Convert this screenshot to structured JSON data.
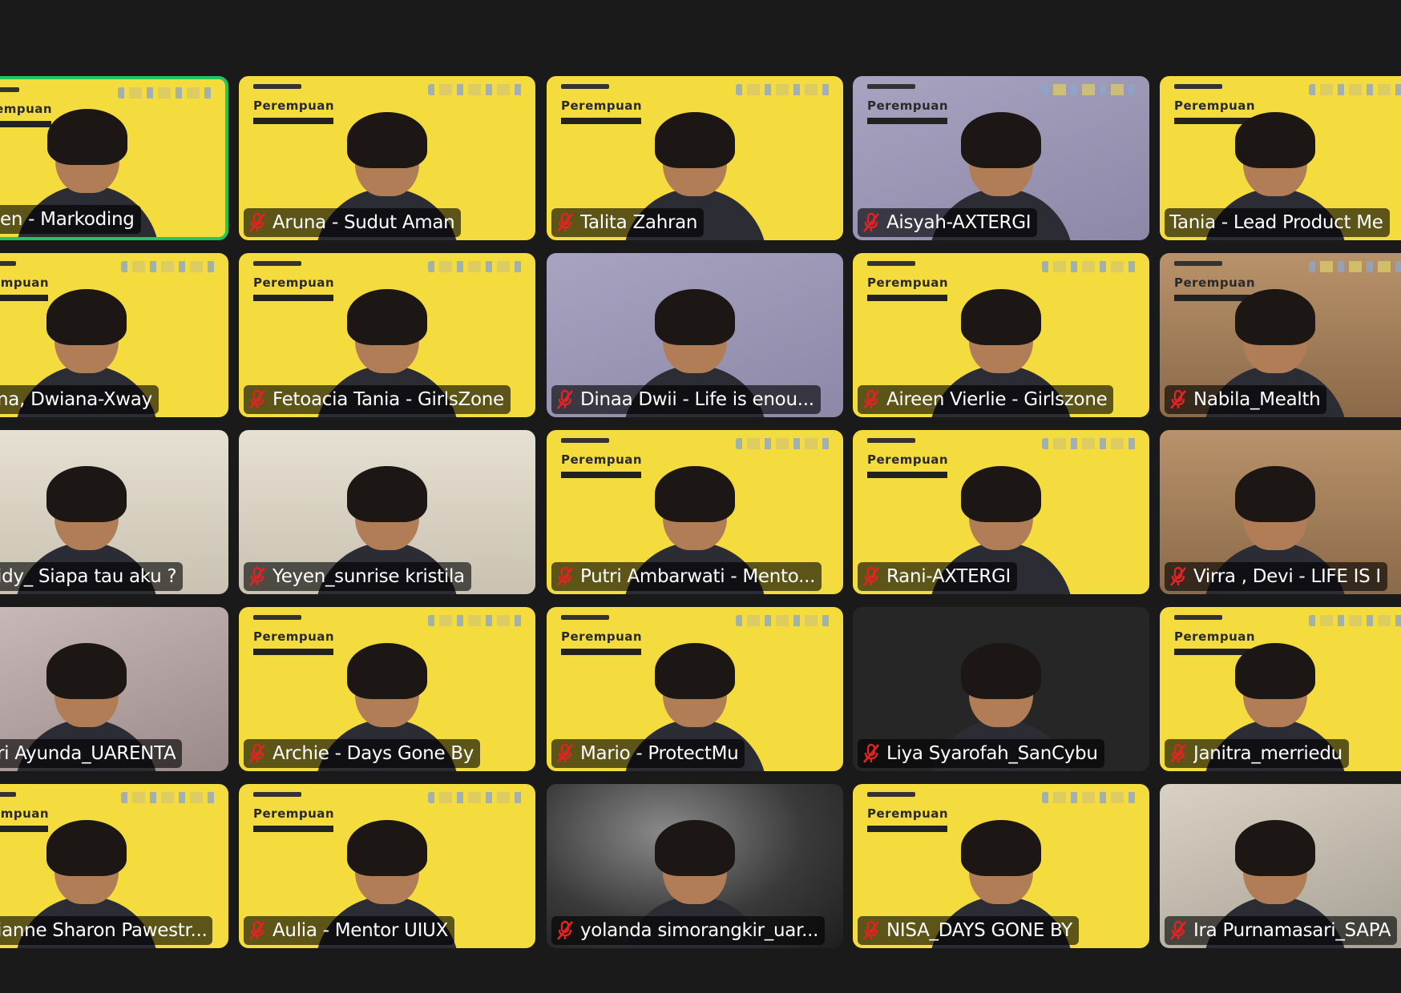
{
  "meeting": {
    "accent_color": "#22c55e",
    "muted_icon": "mic-muted-icon",
    "participants": [
      {
        "id": "p1",
        "name": "en - Markoding",
        "muted": false,
        "active": true,
        "bg": "bg-yellow",
        "branded": true
      },
      {
        "id": "p2",
        "name": "Aruna - Sudut Aman",
        "muted": true,
        "bg": "bg-yellow",
        "branded": true
      },
      {
        "id": "p3",
        "name": "Talita Zahran",
        "muted": true,
        "bg": "bg-yellow",
        "branded": true
      },
      {
        "id": "p4",
        "name": "Aisyah-AXTERGI",
        "muted": true,
        "bg": "bg-purple",
        "branded": true
      },
      {
        "id": "p5",
        "name": "Tania - Lead Product Me",
        "muted": false,
        "bg": "bg-yellow",
        "branded": true
      },
      {
        "id": "p6",
        "name": "na, Dwiana-Xway",
        "muted": false,
        "bg": "bg-yellow",
        "branded": true
      },
      {
        "id": "p7",
        "name": "Fetoacia Tania - GirlsZone",
        "muted": true,
        "bg": "bg-yellow",
        "branded": true
      },
      {
        "id": "p8",
        "name": "Dinaa Dwii - Life is enou...",
        "muted": true,
        "bg": "bg-purple",
        "branded": false
      },
      {
        "id": "p9",
        "name": "Aireen Vierlie - Girlszone",
        "muted": true,
        "bg": "bg-yellow",
        "branded": true
      },
      {
        "id": "p10",
        "name": "Nabila_Mealth",
        "muted": true,
        "bg": "bg-wood",
        "branded": true
      },
      {
        "id": "p11",
        "name": "idy_ Siapa tau aku ?",
        "muted": false,
        "bg": "bg-wall",
        "branded": false
      },
      {
        "id": "p12",
        "name": "Yeyen_sunrise kristila",
        "muted": true,
        "bg": "bg-wall",
        "branded": false
      },
      {
        "id": "p13",
        "name": "Putri Ambarwati - Mento...",
        "muted": true,
        "bg": "bg-yellow",
        "branded": true
      },
      {
        "id": "p14",
        "name": "Rani-AXTERGI",
        "muted": true,
        "bg": "bg-yellow",
        "branded": true
      },
      {
        "id": "p15",
        "name": "Virra , Devi - LIFE IS I",
        "muted": true,
        "bg": "bg-wood",
        "branded": false
      },
      {
        "id": "p16",
        "name": "ri Ayunda_UARENTA",
        "muted": false,
        "bg": "bg-pink",
        "branded": false
      },
      {
        "id": "p17",
        "name": "Archie - Days Gone By",
        "muted": true,
        "bg": "bg-yellow",
        "branded": true
      },
      {
        "id": "p18",
        "name": "Mario - ProtectMu",
        "muted": true,
        "bg": "bg-yellow",
        "branded": true
      },
      {
        "id": "p19",
        "name": "Liya Syarofah_SanCybu",
        "muted": true,
        "bg": "bg-black",
        "branded": false
      },
      {
        "id": "p20",
        "name": "Janitra_merriedu",
        "muted": true,
        "bg": "bg-yellow",
        "branded": true
      },
      {
        "id": "p21",
        "name": "ianne Sharon Pawestr...",
        "muted": false,
        "bg": "bg-yellow",
        "branded": true
      },
      {
        "id": "p22",
        "name": "Aulia - Mentor UIUX",
        "muted": true,
        "bg": "bg-yellow",
        "branded": true
      },
      {
        "id": "p23",
        "name": "yolanda simorangkir_uar...",
        "muted": true,
        "bg": "bg-dark",
        "branded": false
      },
      {
        "id": "p24",
        "name": "NISA_DAYS GONE BY",
        "muted": true,
        "bg": "bg-yellow",
        "branded": true
      },
      {
        "id": "p25",
        "name": "Ira Purnamasari_SAPA",
        "muted": true,
        "bg": "bg-mix",
        "branded": false
      }
    ],
    "branding": {
      "word": "Perempuan"
    }
  }
}
